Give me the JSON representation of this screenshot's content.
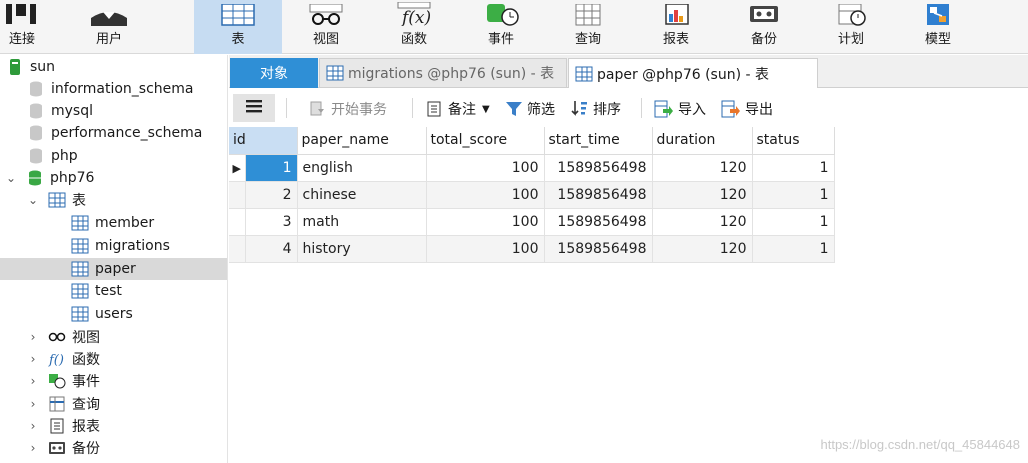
{
  "toolbar": {
    "items": [
      {
        "label": "连接",
        "icon": "connect-icon"
      },
      {
        "label": "用户",
        "icon": "user-icon"
      },
      {
        "label": "表",
        "icon": "table-icon",
        "active": true
      },
      {
        "label": "视图",
        "icon": "view-icon"
      },
      {
        "label": "函数",
        "icon": "function-icon"
      },
      {
        "label": "事件",
        "icon": "event-icon"
      },
      {
        "label": "查询",
        "icon": "query-icon"
      },
      {
        "label": "报表",
        "icon": "report-icon"
      },
      {
        "label": "备份",
        "icon": "backup-icon"
      },
      {
        "label": "计划",
        "icon": "schedule-icon"
      },
      {
        "label": "模型",
        "icon": "model-icon"
      }
    ]
  },
  "sidebar": {
    "connection": "sun",
    "databases": [
      "information_schema",
      "mysql",
      "performance_schema",
      "php",
      "php76"
    ],
    "tables_folder": "表",
    "tables": [
      "member",
      "migrations",
      "paper",
      "test",
      "users"
    ],
    "selected_table": "paper",
    "groups": [
      "视图",
      "函数",
      "事件",
      "查询",
      "报表",
      "备份"
    ]
  },
  "tabs": {
    "objects": "对象",
    "migrations": "migrations @php76 (sun) - 表",
    "paper": "paper @php76 (sun) - 表"
  },
  "subtoolbar": {
    "menu_icon": "hamburger-icon",
    "begin_transaction": "开始事务",
    "memo": "备注",
    "filter": "筛选",
    "sort": "排序",
    "import": "导入",
    "export": "导出"
  },
  "grid": {
    "columns": [
      "id",
      "paper_name",
      "total_score",
      "start_time",
      "duration",
      "status"
    ],
    "rows": [
      [
        "1",
        "english",
        "100",
        "1589856498",
        "120",
        "1"
      ],
      [
        "2",
        "chinese",
        "100",
        "1589856498",
        "120",
        "1"
      ],
      [
        "3",
        "math",
        "100",
        "1589856498",
        "120",
        "1"
      ],
      [
        "4",
        "history",
        "100",
        "1589856498",
        "120",
        "1"
      ]
    ]
  },
  "watermark": "https://blog.csdn.net/qq_45844648",
  "colors": {
    "accent": "#2f8fd6",
    "toolbar_active": "#c6dcf2",
    "selection": "#d9d9d9"
  }
}
